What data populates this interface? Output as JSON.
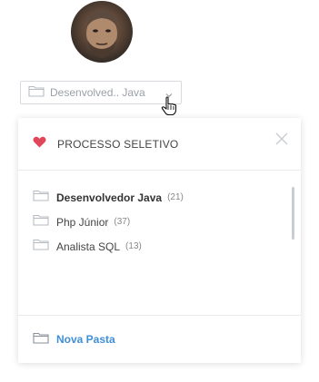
{
  "user": {
    "avatar_icon": "user-avatar-photo"
  },
  "folder_select": {
    "selected_value": "Desenvolved.. Java",
    "icon": "folder-icon",
    "chevron": "chevron-down-icon"
  },
  "panel": {
    "title": "PROCESSO SELETIVO",
    "title_icon": "heart-icon",
    "accent_color": "#e0475a",
    "folders": [
      {
        "name": "Desenvolvedor Java",
        "count": "(21)",
        "active": true
      },
      {
        "name": "Php Júnior",
        "count": "(37)",
        "active": false
      },
      {
        "name": "Analista SQL",
        "count": "(13)",
        "active": false
      }
    ],
    "new_folder_label": "Nova Pasta",
    "link_color": "#3f8fd8"
  }
}
